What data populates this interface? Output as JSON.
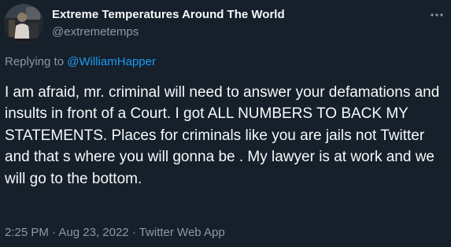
{
  "author": {
    "display_name": "Extreme Temperatures Around The World",
    "handle": "@extremetemps",
    "avatar_icon": "profile-photo-icon"
  },
  "more_icon": "more-options-icon",
  "reply": {
    "prefix": "Replying to",
    "mention": "@WilliamHapper"
  },
  "tweet_text": "I am afraid, mr. criminal will need to answer your defamations and insults in front of a Court. I got ALL NUMBERS TO BACK MY STATEMENTS. Places for criminals like you are jails not Twitter and that s where you will gonna be . My lawyer is at work and we will go to the bottom.",
  "meta": {
    "time": "2:25 PM",
    "separator1": "·",
    "date": "Aug 23, 2022",
    "separator2": "·",
    "source": "Twitter Web App"
  },
  "colors": {
    "background": "#15202b",
    "primary_text": "#f7f9f9",
    "secondary_text": "#8b98a5",
    "link": "#1d9bf0"
  }
}
